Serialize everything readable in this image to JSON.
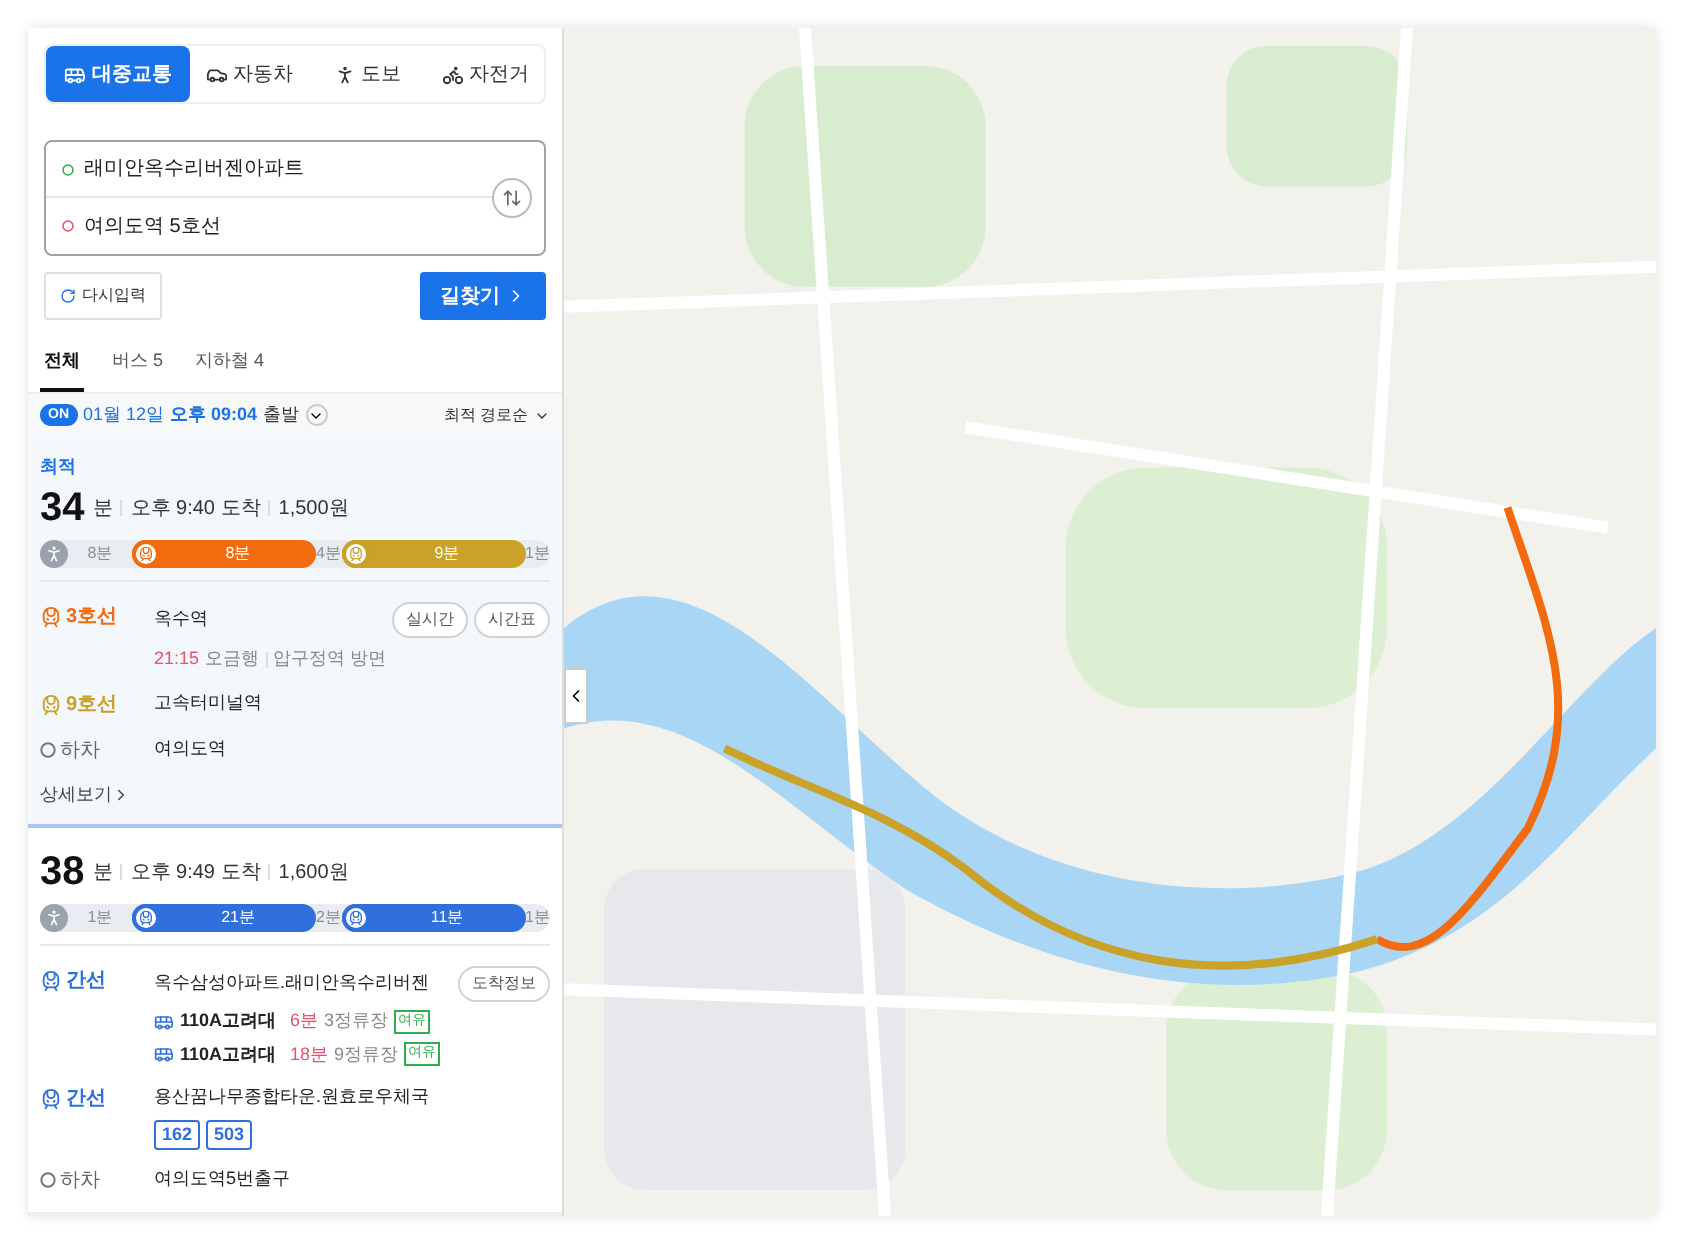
{
  "modes": [
    {
      "kind": "transit",
      "label": "대중교통",
      "selected": true
    },
    {
      "kind": "car",
      "label": "자동차",
      "selected": false
    },
    {
      "kind": "walk",
      "label": "도보",
      "selected": false
    },
    {
      "kind": "bike",
      "label": "자전거",
      "selected": false
    }
  ],
  "origin": "래미안옥수리버젠아파트",
  "destination": "여의도역 5호선",
  "reset_button": "다시입력",
  "search_button": "길찾기",
  "result_tabs": [
    {
      "label": "전체",
      "selected": true
    },
    {
      "label": "버스 5",
      "selected": false
    },
    {
      "label": "지하철 4",
      "selected": false
    }
  ],
  "departure": {
    "badge": "ON",
    "date": "01월 12일",
    "time": "오후 09:04",
    "suffix": "출발",
    "sort": "최적 경로순"
  },
  "routes": [
    {
      "selected": true,
      "tag": "최적",
      "minutes": "34",
      "unit": "분",
      "arrival": "오후 9:40 도착",
      "fare": "1,500원",
      "segments": [
        {
          "kind": "walk",
          "label": "8분"
        },
        {
          "kind": "transit",
          "label": "8분",
          "color": "#f26b0f"
        },
        {
          "kind": "gap",
          "label": "4분"
        },
        {
          "kind": "transit",
          "label": "9분",
          "color": "#c9a227"
        },
        {
          "kind": "gap",
          "label": "1분"
        }
      ],
      "steps": [
        {
          "kind": "line",
          "line": "3호선",
          "color": "#f26b0f",
          "station": "옥수역",
          "buttons": [
            "실시간",
            "시간표"
          ],
          "info": {
            "time": "21:15",
            "text": "오금행",
            "direction": "압구정역 방면"
          }
        },
        {
          "kind": "line",
          "line": "9호선",
          "color": "#c9a227",
          "station": "고속터미널역"
        },
        {
          "kind": "alight",
          "line": "하차",
          "station": "여의도역"
        }
      ],
      "detail_link": "상세보기"
    },
    {
      "selected": false,
      "minutes": "38",
      "unit": "분",
      "arrival": "오후 9:49 도착",
      "fare": "1,600원",
      "segments": [
        {
          "kind": "walk",
          "label": "1분"
        },
        {
          "kind": "transit",
          "label": "21분",
          "color": "#2f6fde"
        },
        {
          "kind": "gap",
          "label": "2분"
        },
        {
          "kind": "transit",
          "label": "11분",
          "color": "#2f6fde"
        },
        {
          "kind": "gap",
          "label": "1분"
        }
      ],
      "steps": [
        {
          "kind": "line",
          "line": "간선",
          "color": "#2f6fde",
          "station": "옥수삼성아파트.래미안옥수리버젠",
          "buttons": [
            "도착정보"
          ],
          "arrivals": [
            {
              "bus": "110A고려대",
              "eta": "6분",
              "stops": "3정류장",
              "crowd": "여유"
            },
            {
              "bus": "110A고려대",
              "eta": "18분",
              "stops": "9정류장",
              "crowd": "여유"
            }
          ]
        },
        {
          "kind": "line",
          "line": "간선",
          "color": "#2f6fde",
          "station": "용산꿈나무종합타운.원효로우체국",
          "bus_numbers": [
            "162",
            "503"
          ]
        },
        {
          "kind": "alight",
          "line": "하차",
          "station": "여의도역5번출구"
        }
      ]
    }
  ]
}
